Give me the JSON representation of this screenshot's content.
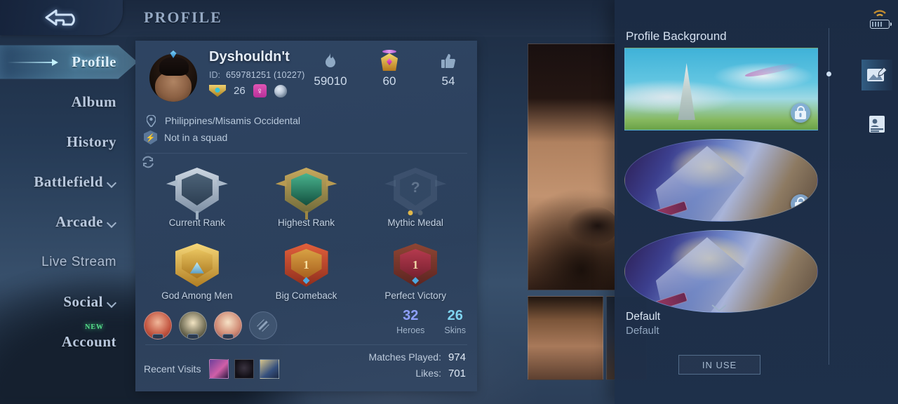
{
  "header": {
    "title": "PROFILE",
    "back_icon": "back-arrow-icon"
  },
  "sidebar": {
    "items": [
      {
        "label": "Profile",
        "active": true,
        "expandable": false,
        "font": "serif"
      },
      {
        "label": "Album",
        "active": false,
        "expandable": false,
        "font": "serif"
      },
      {
        "label": "History",
        "active": false,
        "expandable": false,
        "font": "serif"
      },
      {
        "label": "Battlefield",
        "active": false,
        "expandable": true,
        "font": "serif"
      },
      {
        "label": "Arcade",
        "active": false,
        "expandable": true,
        "font": "serif"
      },
      {
        "label": "Live Stream",
        "active": false,
        "expandable": false,
        "font": "sans"
      },
      {
        "label": "Social",
        "active": false,
        "expandable": true,
        "font": "serif"
      },
      {
        "label": "Account",
        "active": false,
        "expandable": false,
        "font": "serif",
        "badge": "NEW"
      }
    ]
  },
  "profile": {
    "name": "Dyshouldn't",
    "id_label": "ID:",
    "id_value": "659781251 (10227)",
    "level": "26",
    "gender_icon": "female-icon",
    "zodiac_icon": "moon-icon",
    "location": "Philippines/Misamis Occidental",
    "squad": "Not in a squad",
    "stats": [
      {
        "icon": "flame-icon",
        "value": "59010"
      },
      {
        "icon": "medal-icon",
        "value": "60"
      },
      {
        "icon": "thumbs-up-icon",
        "value": "54"
      }
    ]
  },
  "badges": {
    "refresh_icon": "refresh-icon",
    "items": [
      {
        "label": "Current Rank",
        "style": "silver"
      },
      {
        "label": "Highest Rank",
        "style": "emerald"
      },
      {
        "label": "Mythic Medal",
        "style": "empty",
        "placeholder": "?"
      },
      {
        "label": "God Among Men",
        "style": "gold"
      },
      {
        "label": "Big Comeback",
        "style": "red"
      },
      {
        "label": "Perfect Victory",
        "style": "crimson"
      }
    ]
  },
  "collection": {
    "heroes_value": "32",
    "heroes_label": "Heroes",
    "skins_value": "26",
    "skins_label": "Skins",
    "heroes_color": "#8e9ffb",
    "skins_color": "#7fd4f0"
  },
  "recent": {
    "label": "Recent Visits",
    "count": 3
  },
  "matches": {
    "played_label": "Matches Played:",
    "played_value": "974",
    "likes_label": "Likes:",
    "likes_value": "701"
  },
  "right_panel": {
    "title": "Profile Background",
    "backgrounds": [
      {
        "style": "sky",
        "locked": true
      },
      {
        "style": "hero",
        "locked": true
      },
      {
        "style": "hero",
        "locked": false
      }
    ],
    "selected_name": "Default",
    "selected_sub": "Default",
    "button_label": "IN USE",
    "rail": [
      {
        "icon": "image-edit-icon",
        "active": true
      },
      {
        "icon": "id-card-icon",
        "active": false
      }
    ]
  },
  "statusbar": {
    "wifi_icon": "wifi-icon",
    "battery_icon": "battery-icon"
  }
}
